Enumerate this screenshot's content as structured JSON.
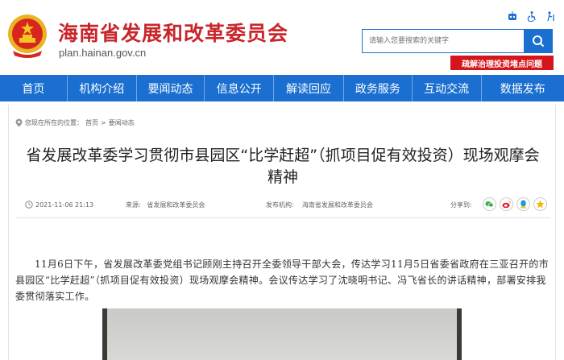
{
  "header": {
    "site_title": "海南省发展和改革委员会",
    "domain": "plan.hainan.gov.cn",
    "search_placeholder": "请输入您要搜索的关键字",
    "banner": "疏解治理投资堵点问题",
    "colors": {
      "brand_red": "#c8262b",
      "nav_blue": "#1a6fd0",
      "banner_red": "#d4161c"
    }
  },
  "nav": {
    "items": [
      {
        "label": "首页"
      },
      {
        "label": "机构介绍"
      },
      {
        "label": "要闻动态"
      },
      {
        "label": "信息公开"
      },
      {
        "label": "解读回应"
      },
      {
        "label": "政务服务"
      },
      {
        "label": "互动交流"
      },
      {
        "label": "数据发布"
      }
    ]
  },
  "breadcrumb": {
    "prefix": "您现在所在的位置：",
    "home": "首页",
    "sep": ">",
    "current": "要闻动态"
  },
  "article": {
    "title": "省发展改革委学习贯彻市县园区“比学赶超”（抓项目促有效投资）现场观摩会精神",
    "date": "2021-11-06 21:13",
    "source_label": "来源:",
    "source": "省发展和改革委员会",
    "publisher_label": "发布机构:",
    "publisher": "海南省发展和改革委员会",
    "share_label": "分享到:",
    "body": "11月6日下午，省发展改革委党组书记顾刚主持召开全委领导干部大会，传达学习11月5日省委省政府在三亚召开的市县园区“比学赶超”（抓项目促有效投资）现场观摩会精神。会议传达学习了沈晓明书记、冯飞省长的讲话精神，部署安排我委贯彻落实工作。"
  }
}
